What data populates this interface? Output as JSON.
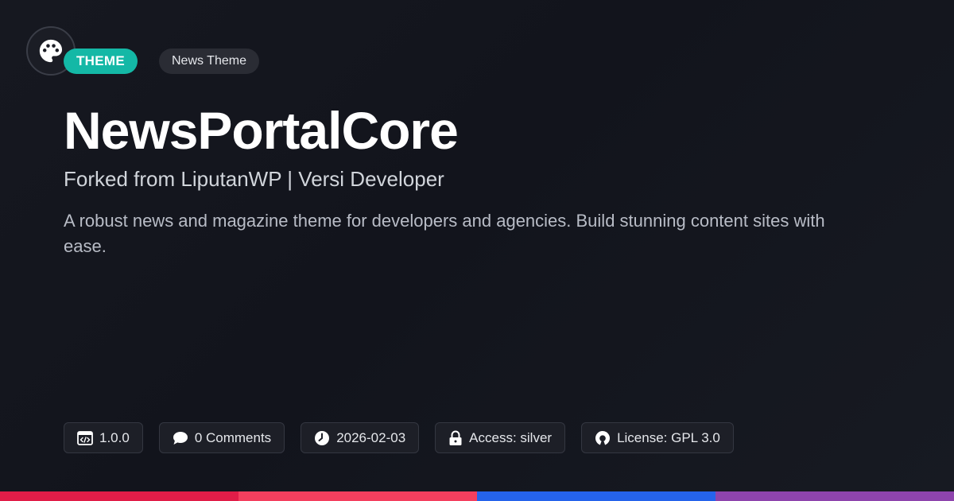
{
  "header": {
    "type_badge": "THEME",
    "category_badge": "News Theme"
  },
  "title": "NewsPortalCore",
  "subtitle": "Forked from LiputanWP | Versi Developer",
  "description": "A robust news and magazine theme for developers and agencies. Build stunning content sites with ease.",
  "meta": {
    "version": "1.0.0",
    "comments": "0 Comments",
    "date": "2026-02-03",
    "access": "Access: silver",
    "license": "License: GPL 3.0"
  },
  "icons": {
    "logo": "palette-icon",
    "version": "code-window-icon",
    "comments": "speech-bubble-icon",
    "date": "clock-icon",
    "access": "lock-icon",
    "license": "open-source-icon"
  },
  "colors": {
    "accent_teal": "#14b8a6",
    "bar_segments": [
      "#e11d48",
      "#f43f5e",
      "#2563eb",
      "#8e44ad"
    ]
  }
}
